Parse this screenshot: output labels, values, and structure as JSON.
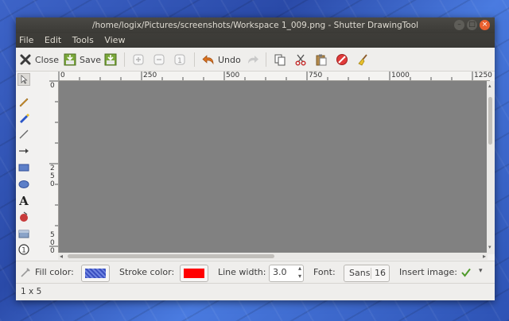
{
  "window": {
    "title": "/home/logix/Pictures/screenshots/Workspace 1_009.png - Shutter DrawingTool"
  },
  "menu": {
    "items": [
      "File",
      "Edit",
      "Tools",
      "View"
    ]
  },
  "toolbar": {
    "close_label": "Close",
    "save_label": "Save",
    "undo_label": "Undo"
  },
  "ruler": {
    "h_labels": [
      "0",
      "250",
      "500",
      "750",
      "1000",
      "1250"
    ],
    "v_labels": [
      "0",
      "250",
      "500"
    ]
  },
  "bottom": {
    "fill_label": "Fill color:",
    "stroke_label": "Stroke color:",
    "line_width_label": "Line width:",
    "line_width_value": "3.0",
    "font_label": "Font:",
    "font_name": "Sans",
    "font_size": "16",
    "insert_label": "Insert image:"
  },
  "colors": {
    "fill": "#3a4fc0",
    "stroke": "#ff0000",
    "canvas": "#818181"
  },
  "status": {
    "text": "1 x 5"
  }
}
